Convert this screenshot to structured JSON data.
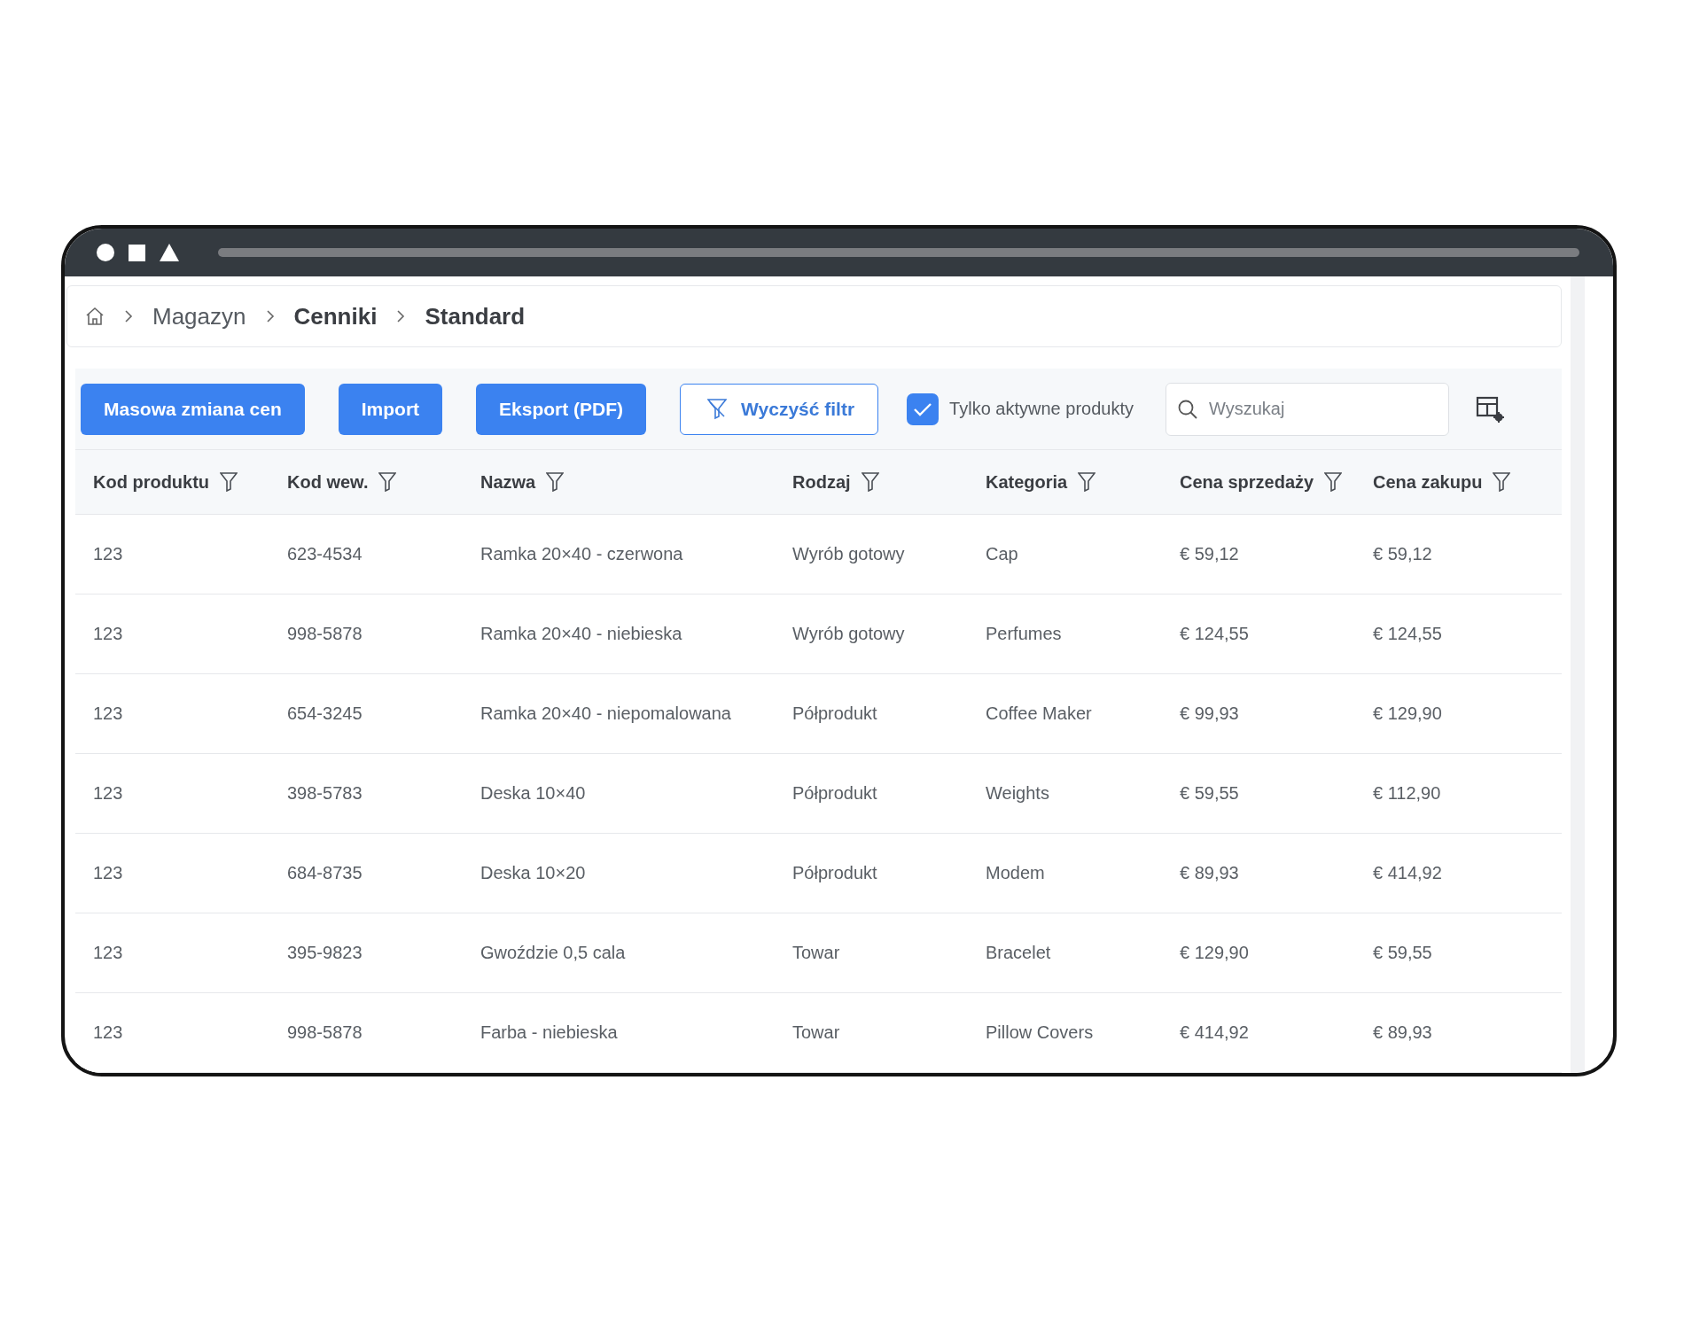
{
  "breadcrumb": [
    {
      "label": "Magazyn",
      "bold": false
    },
    {
      "label": "Cenniki",
      "bold": true
    },
    {
      "label": "Standard",
      "bold": true
    }
  ],
  "toolbar": {
    "buttons": [
      {
        "label": "Masowa zmiana cen",
        "kind": "primary"
      },
      {
        "label": "Import",
        "kind": "primary"
      },
      {
        "label": "Eksport (PDF)",
        "kind": "primary"
      },
      {
        "label": "Wyczyść filtr",
        "kind": "outline"
      }
    ],
    "active_only": {
      "label": "Tylko aktywne produkty",
      "checked": true
    },
    "search": {
      "placeholder": "Wyszukaj"
    }
  },
  "table": {
    "columns": [
      "Kod produktu",
      "Kod wew.",
      "Nazwa",
      "Rodzaj",
      "Kategoria",
      "Cena sprzedaży",
      "Cena zakupu"
    ],
    "rows": [
      [
        "123",
        "623-4534",
        "Ramka 20×40 - czerwona",
        "Wyrób gotowy",
        "Cap",
        "€ 59,12",
        "€ 59,12"
      ],
      [
        "123",
        "998-5878",
        "Ramka 20×40 - niebieska",
        "Wyrób gotowy",
        "Perfumes",
        "€ 124,55",
        "€ 124,55"
      ],
      [
        "123",
        "654-3245",
        "Ramka 20×40 - niepomalowana",
        "Półprodukt",
        "Coffee Maker",
        "€ 99,93",
        "€ 129,90"
      ],
      [
        "123",
        "398-5783",
        "Deska 10×40",
        "Półprodukt",
        "Weights",
        "€ 59,55",
        "€ 112,90"
      ],
      [
        "123",
        "684-8735",
        "Deska 10×20",
        "Półprodukt",
        "Modem",
        "€ 89,93",
        "€ 414,92"
      ],
      [
        "123",
        "395-9823",
        "Gwoździe 0,5 cala",
        "Towar",
        "Bracelet",
        "€ 129,90",
        "€ 59,55"
      ],
      [
        "123",
        "998-5878",
        "Farba - niebieska",
        "Towar",
        "Pillow Covers",
        "€ 414,92",
        "€ 89,93"
      ]
    ]
  }
}
